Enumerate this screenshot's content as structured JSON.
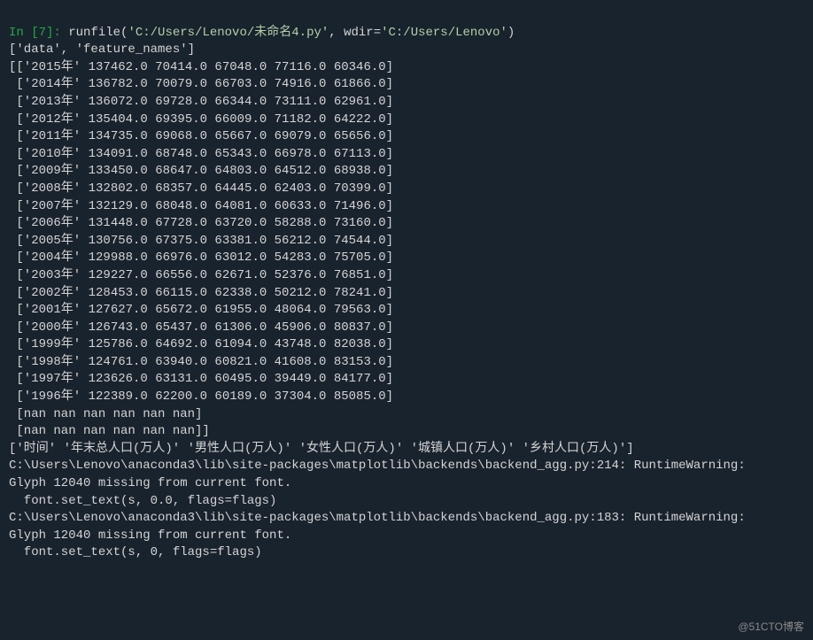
{
  "prompt": {
    "label": "In [7]:",
    "call_pre": "runfile(",
    "arg1": "'C:/Users/Lenovo/未命名4.py'",
    "mid": ", wdir=",
    "arg2": "'C:/Users/Lenovo'",
    "call_post": ")"
  },
  "keys_line": "['data', 'feature_names']",
  "data_rows": [
    "[['2015年' 137462.0 70414.0 67048.0 77116.0 60346.0]",
    " ['2014年' 136782.0 70079.0 66703.0 74916.0 61866.0]",
    " ['2013年' 136072.0 69728.0 66344.0 73111.0 62961.0]",
    " ['2012年' 135404.0 69395.0 66009.0 71182.0 64222.0]",
    " ['2011年' 134735.0 69068.0 65667.0 69079.0 65656.0]",
    " ['2010年' 134091.0 68748.0 65343.0 66978.0 67113.0]",
    " ['2009年' 133450.0 68647.0 64803.0 64512.0 68938.0]",
    " ['2008年' 132802.0 68357.0 64445.0 62403.0 70399.0]",
    " ['2007年' 132129.0 68048.0 64081.0 60633.0 71496.0]",
    " ['2006年' 131448.0 67728.0 63720.0 58288.0 73160.0]",
    " ['2005年' 130756.0 67375.0 63381.0 56212.0 74544.0]",
    " ['2004年' 129988.0 66976.0 63012.0 54283.0 75705.0]",
    " ['2003年' 129227.0 66556.0 62671.0 52376.0 76851.0]",
    " ['2002年' 128453.0 66115.0 62338.0 50212.0 78241.0]",
    " ['2001年' 127627.0 65672.0 61955.0 48064.0 79563.0]",
    " ['2000年' 126743.0 65437.0 61306.0 45906.0 80837.0]",
    " ['1999年' 125786.0 64692.0 61094.0 43748.0 82038.0]",
    " ['1998年' 124761.0 63940.0 60821.0 41608.0 83153.0]",
    " ['1997年' 123626.0 63131.0 60495.0 39449.0 84177.0]",
    " ['1996年' 122389.0 62200.0 60189.0 37304.0 85085.0]",
    " [nan nan nan nan nan nan]",
    " [nan nan nan nan nan nan]]"
  ],
  "feature_names_line": "['时间' '年末总人口(万人)' '男性人口(万人)' '女性人口(万人)' '城镇人口(万人)' '乡村人口(万人)']",
  "warnings": [
    "C:\\Users\\Lenovo\\anaconda3\\lib\\site-packages\\matplotlib\\backends\\backend_agg.py:214: RuntimeWarning:",
    "Glyph 12040 missing from current font.",
    "  font.set_text(s, 0.0, flags=flags)",
    "C:\\Users\\Lenovo\\anaconda3\\lib\\site-packages\\matplotlib\\backends\\backend_agg.py:183: RuntimeWarning:",
    "Glyph 12040 missing from current font.",
    "  font.set_text(s, 0, flags=flags)"
  ],
  "watermark": "@51CTO博客"
}
